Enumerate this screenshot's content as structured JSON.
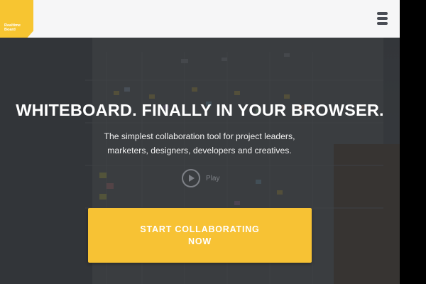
{
  "header": {
    "logo_text": "Realtime\nBoard",
    "menu_icon": "hamburger-menu-icon"
  },
  "hero": {
    "headline": "WHITEBOARD. FINALLY IN YOUR BROWSER.",
    "subtitle": "The simplest collaboration tool for project leaders, marketers, designers, developers and creatives.",
    "play_label": "Play",
    "play_icon": "play-icon",
    "cta_label": "START COLLABORATING NOW"
  },
  "colors": {
    "accent": "#f7c234",
    "header_bg": "#f6f6f7",
    "hero_bg": "#3a3d41"
  }
}
